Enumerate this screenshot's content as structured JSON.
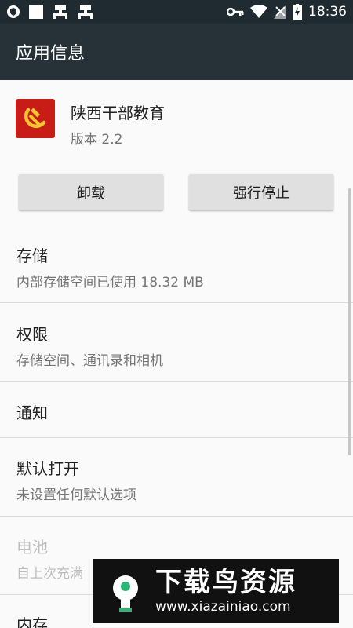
{
  "status_bar": {
    "time": "18:36",
    "icons": [
      "vpn-shield-icon",
      "notification-square-icon",
      "bug-icon",
      "bug-icon",
      "key-icon",
      "wifi-icon",
      "no-sim-icon",
      "battery-charging-icon"
    ]
  },
  "app_bar": {
    "title": "应用信息"
  },
  "app": {
    "name": "陕西干部教育",
    "version": "版本 2.2"
  },
  "buttons": {
    "uninstall": "卸载",
    "force_stop": "强行停止"
  },
  "items": [
    {
      "title": "存储",
      "summary": "内部存储空间已使用 18.32 MB",
      "enabled": true
    },
    {
      "title": "权限",
      "summary": "存储空间、通讯录和相机",
      "enabled": true
    },
    {
      "title": "通知",
      "summary": "",
      "enabled": true
    },
    {
      "title": "默认打开",
      "summary": "未设置任何默认选项",
      "enabled": true
    },
    {
      "title": "电池",
      "summary": "自上次充满",
      "enabled": false
    },
    {
      "title": "内存",
      "summary": "",
      "enabled": true
    }
  ],
  "watermark": {
    "title": "下载鸟资源",
    "url": "www.xiazainiao.com"
  },
  "colors": {
    "status_bar": "#1f2b30",
    "app_bar": "#263238",
    "app_icon": "#c81d16",
    "background": "#fafafa"
  }
}
